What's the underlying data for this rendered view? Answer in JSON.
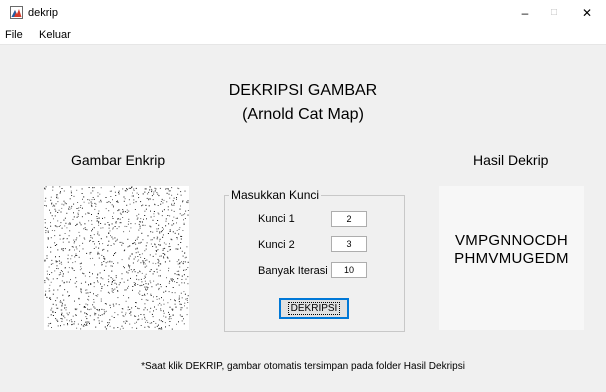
{
  "window": {
    "title": "dekrip",
    "controls": {
      "minimize": "–",
      "maximize": "□",
      "close": "✕"
    }
  },
  "menu": [
    "File",
    "Keluar"
  ],
  "main": {
    "title_line1": "DEKRIPSI GAMBAR",
    "title_line2": "(Arnold Cat Map)",
    "left_label": "Gambar Enkrip",
    "right_label": "Hasil Dekrip",
    "result_line1": "VMPGNNOCDH",
    "result_line2": "PHMVMUGEDM",
    "note": "*Saat klik DEKRIP, gambar otomatis tersimpan pada folder Hasil Dekripsi"
  },
  "key_panel": {
    "title": "Masukkan Kunci",
    "fields": [
      {
        "label": "Kunci 1",
        "value": "2"
      },
      {
        "label": "Kunci 2",
        "value": "3"
      },
      {
        "label": "Banyak Iterasi",
        "value": "10"
      }
    ],
    "button": "DEKRIPSI"
  },
  "colors": {
    "client_bg": "#f0f0f0",
    "button_focus": "#0078d7",
    "icon_red": "#d63a2a"
  }
}
